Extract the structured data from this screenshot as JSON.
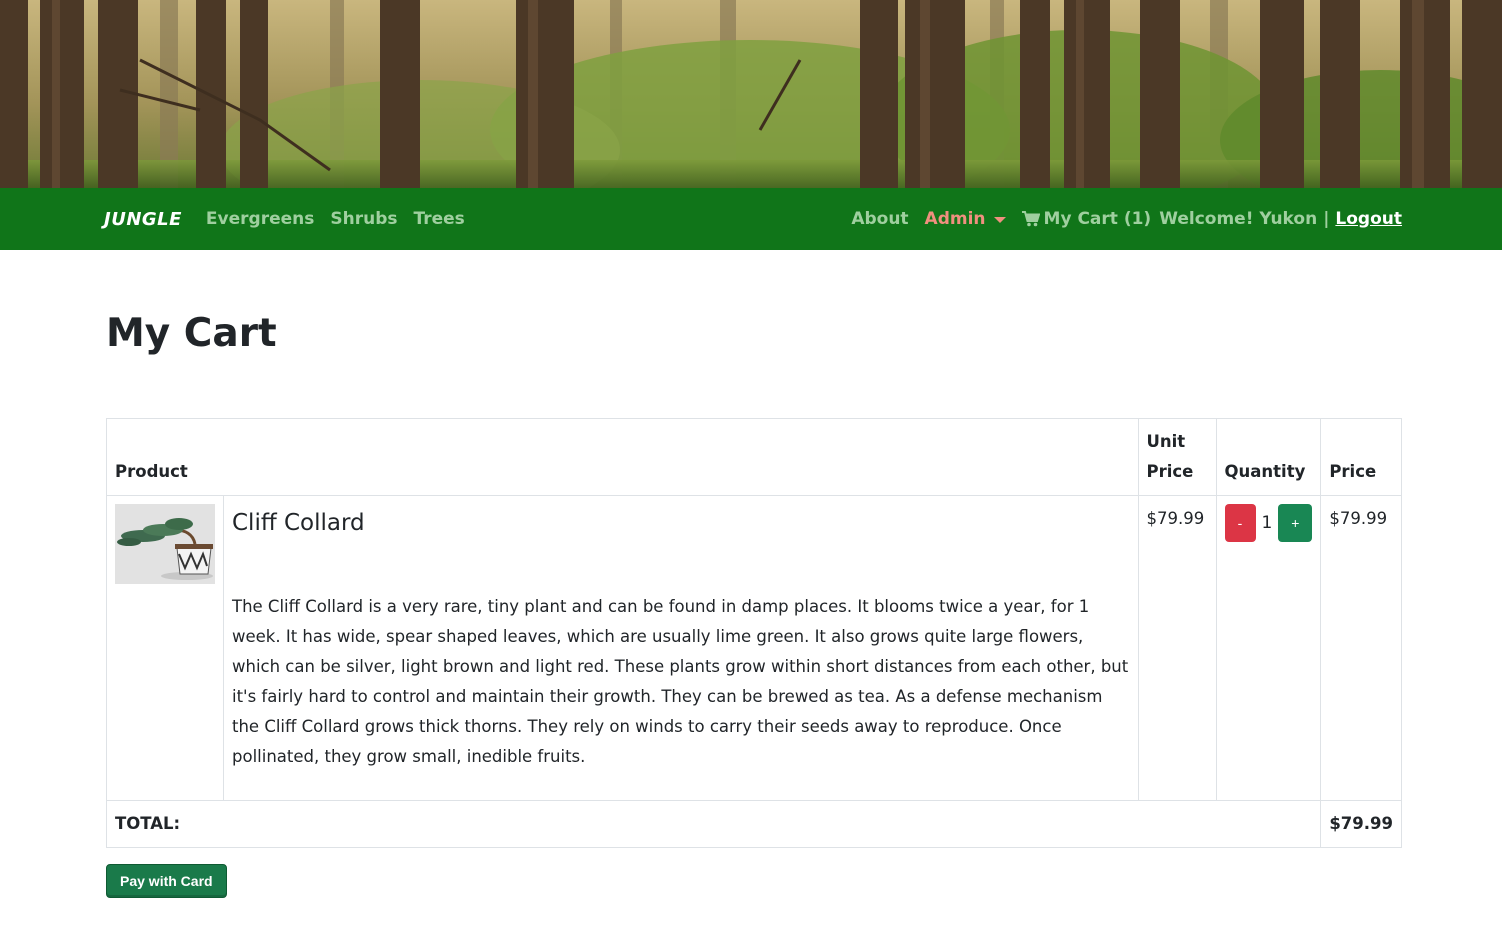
{
  "nav": {
    "brand": "JUNGLE",
    "left_links": [
      "Evergreens",
      "Shrubs",
      "Trees"
    ],
    "about": "About",
    "admin": "Admin",
    "cart": "My Cart (1)",
    "welcome": "Welcome! Yukon",
    "separator": "|",
    "logout": "Logout",
    "colors": {
      "navbar_bg": "#107519",
      "link": "#9fcf9f",
      "admin": "#f0907f",
      "logout": "#ffffff"
    }
  },
  "page": {
    "title": "My Cart"
  },
  "table": {
    "headers": {
      "product": "Product",
      "unit_price": "Unit Price",
      "quantity": "Quantity",
      "price": "Price"
    },
    "rows": [
      {
        "name": "Cliff Collard",
        "description": "The Cliff Collard is a very rare, tiny plant and can be found in damp places. It blooms twice a year, for 1 week. It has wide, spear shaped leaves, which are usually lime green. It also grows quite large flowers, which can be silver, light brown and light red. These plants grow within short distances from each other, but it's fairly hard to control and maintain their growth. They can be brewed as tea. As a defense mechanism the Cliff Collard grows thick thorns. They rely on winds to carry their seeds away to reproduce. Once pollinated, they grow small, inedible fruits.",
        "unit_price": "$79.99",
        "quantity": "1",
        "price": "$79.99",
        "minus_label": "-",
        "plus_label": "+"
      }
    ],
    "total_label": "TOTAL:",
    "total_value": "$79.99"
  },
  "actions": {
    "pay_label": "Pay with Card",
    "colors": {
      "pay": "#1a7a4a",
      "minus": "#dc3545",
      "plus": "#198754"
    }
  },
  "icons": {
    "cart": "shopping-cart-icon",
    "admin_caret": "caret-down-icon"
  }
}
